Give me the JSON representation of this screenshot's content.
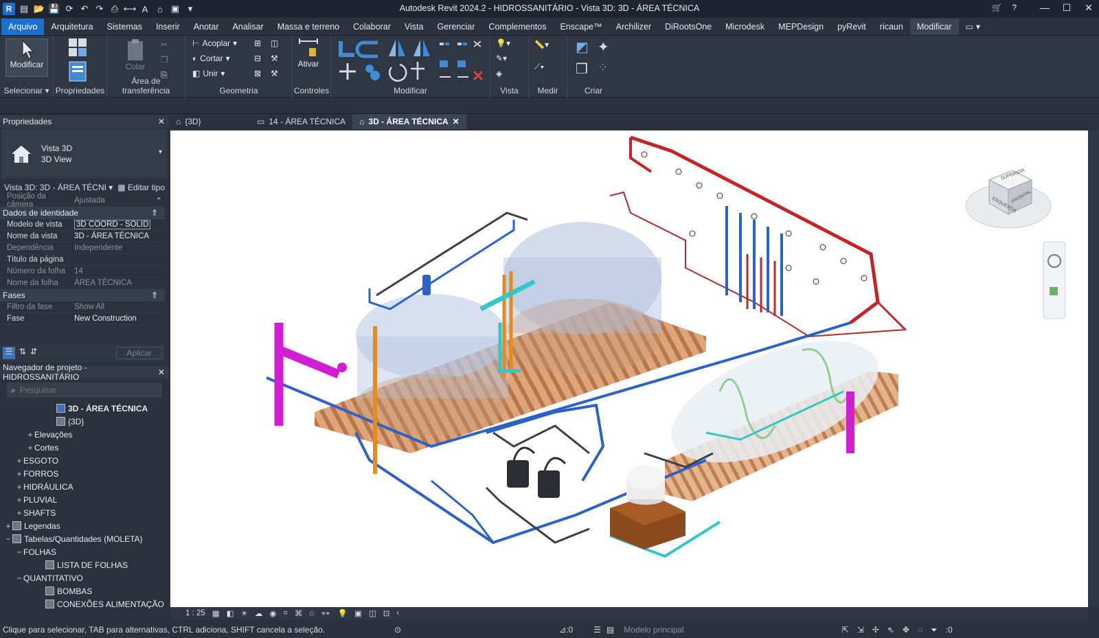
{
  "app": {
    "title": "Autodesk Revit 2024.2 - HIDROSSANITÁRIO - Vista 3D: 3D - ÁREA TÉCNICA",
    "logo": "R"
  },
  "menu": [
    "Arquivo",
    "Arquitetura",
    "Sistemas",
    "Inserir",
    "Anotar",
    "Analisar",
    "Massa e terreno",
    "Colaborar",
    "Vista",
    "Gerenciar",
    "Complementos",
    "Enscape™",
    "Archilizer",
    "DiRootsOne",
    "Microdesk",
    "MEPDesign",
    "pyRevit",
    "ricaun",
    "Modificar"
  ],
  "ribbon": {
    "modificar": "Modificar",
    "selecionar": "Selecionar ▾",
    "propriedades": "Propriedades",
    "colar": "Colar",
    "area_transferencia": "Área de transferência",
    "acoplar": "Acoplar",
    "cortar": "Cortar",
    "unir": "Unir",
    "geometria": "Geometria",
    "ativar": "Ativar",
    "controles": "Controles",
    "modificar_panel": "Modificar",
    "vista": "Vista",
    "medir": "Medir",
    "criar": "Criar"
  },
  "properties": {
    "header": "Propriedades",
    "type_line1": "Vista 3D",
    "type_line2": "3D View",
    "selector": "Vista 3D: 3D - ÁREA TÉCNI",
    "edit_type": "Editar tipo",
    "camera_k": "Posição da câmera",
    "camera_v": "Ajustada",
    "sec_identity": "Dados de identidade",
    "rows": [
      {
        "k": "Modelo de vista",
        "v": "3D COORD - SOLID"
      },
      {
        "k": "Nome da vista",
        "v": "3D - ÁREA TÉCNICA"
      },
      {
        "k": "Dependência",
        "v": "Independente"
      },
      {
        "k": "Título da página",
        "v": ""
      },
      {
        "k": "Número da folha",
        "v": "14"
      },
      {
        "k": "Nome da folha",
        "v": "ÁREA TÉCNICA"
      }
    ],
    "sec_phases": "Fases",
    "phase_rows": [
      {
        "k": "Filtro da fase",
        "v": "Show All"
      },
      {
        "k": "Fase",
        "v": "New Construction"
      }
    ],
    "apply": "Aplicar"
  },
  "browser": {
    "header": "Navegador de projeto - HIDROSSANITÁRIO",
    "search_placeholder": "Pesquisar",
    "items": [
      {
        "label": "3D - ÁREA TÉCNICA",
        "indent": 4,
        "pm": "",
        "icon": true,
        "bold": true
      },
      {
        "label": "{3D}",
        "indent": 4,
        "pm": "",
        "icon": true,
        "bold": false
      },
      {
        "label": "Elevações",
        "indent": 2,
        "pm": "+",
        "icon": false,
        "bold": false
      },
      {
        "label": "Cortes",
        "indent": 2,
        "pm": "+",
        "icon": false,
        "bold": false
      },
      {
        "label": "ESGOTO",
        "indent": 1,
        "pm": "+",
        "icon": false,
        "bold": false
      },
      {
        "label": "FORROS",
        "indent": 1,
        "pm": "+",
        "icon": false,
        "bold": false
      },
      {
        "label": "HIDRÁULICA",
        "indent": 1,
        "pm": "+",
        "icon": false,
        "bold": false
      },
      {
        "label": "PLUVIAL",
        "indent": 1,
        "pm": "+",
        "icon": false,
        "bold": false
      },
      {
        "label": "SHAFTS",
        "indent": 1,
        "pm": "+",
        "icon": false,
        "bold": false
      },
      {
        "label": "Legendas",
        "indent": 0,
        "pm": "+",
        "icon": true,
        "bold": false
      },
      {
        "label": "Tabelas/Quantidades (MOLETA)",
        "indent": 0,
        "pm": "−",
        "icon": true,
        "bold": false
      },
      {
        "label": "FOLHAS",
        "indent": 1,
        "pm": "−",
        "icon": false,
        "bold": false
      },
      {
        "label": "LISTA DE FOLHAS",
        "indent": 3,
        "pm": "",
        "icon": true,
        "bold": false
      },
      {
        "label": "QUANTITATIVO",
        "indent": 1,
        "pm": "−",
        "icon": false,
        "bold": false
      },
      {
        "label": "BOMBAS",
        "indent": 3,
        "pm": "",
        "icon": true,
        "bold": false
      },
      {
        "label": "CONEXÕES ALIMENTAÇÃO",
        "indent": 3,
        "pm": "",
        "icon": true,
        "bold": false
      }
    ]
  },
  "tabs": [
    {
      "label": "{3D}",
      "active": false
    },
    {
      "label": "14 - ÁREA TÉCNICA",
      "active": false
    },
    {
      "label": "3D - ÁREA TÉCNICA",
      "active": true
    }
  ],
  "viewbar": {
    "scale": "1 : 25"
  },
  "viewcube": {
    "top": "SUPERIOR",
    "left": "ESQUERDA",
    "right": "FRONTAL"
  },
  "status": {
    "hint": "Clique para selecionar, TAB para alternativas, CTRL adiciona, SHIFT cancela a seleção.",
    "count": ":0",
    "model": "Modelo principal",
    "filter": ":0"
  },
  "colors": {
    "accent": "#1a6fd1",
    "hot": "#cc2222",
    "cold": "#2a62c9",
    "magenta": "#d21ed2",
    "orange": "#e58a1e",
    "cyan": "#33c7c7",
    "wood": "#c98a5a"
  }
}
